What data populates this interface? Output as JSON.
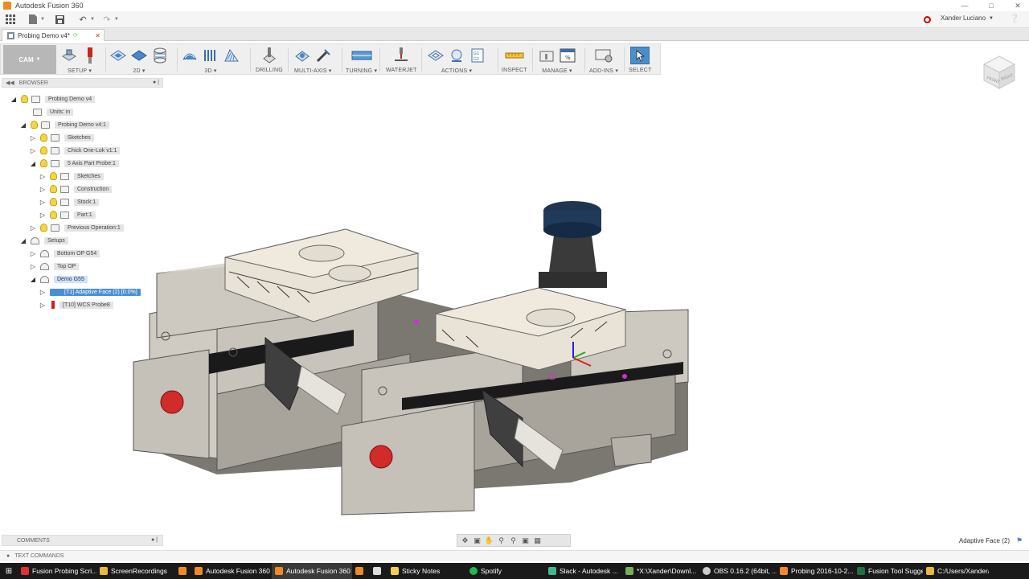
{
  "window": {
    "title": "Autodesk Fusion 360",
    "app_icon": "fusion-icon"
  },
  "quick_access": {
    "icons": [
      "grid-icon",
      "file-icon",
      "save-icon",
      "undo-icon",
      "redo-icon"
    ],
    "user": "Xander Luciano",
    "help": "?"
  },
  "document_tab": {
    "label": "Probing Demo v4*"
  },
  "toolbar": {
    "workspace": "CAM",
    "groups": [
      {
        "label": "SETUP",
        "dropdown": true,
        "icons": [
          "setup-icon",
          "tool-library-icon"
        ]
      },
      {
        "label": "2D",
        "dropdown": true,
        "icons": [
          "2d-adaptive-icon",
          "2d-pocket-icon",
          "2d-contour-icon"
        ]
      },
      {
        "label": "3D",
        "dropdown": true,
        "icons": [
          "3d-adaptive-icon",
          "3d-parallel-icon",
          "3d-scallop-icon"
        ]
      },
      {
        "label": "DRILLING",
        "dropdown": false,
        "icons": [
          "drill-icon"
        ]
      },
      {
        "label": "MULTI-AXIS",
        "dropdown": true,
        "icons": [
          "multi-axis-icon",
          "swarf-icon"
        ]
      },
      {
        "label": "TURNING",
        "dropdown": true,
        "icons": [
          "turning-icon"
        ]
      },
      {
        "label": "WATERJET",
        "dropdown": false,
        "icons": [
          "waterjet-icon"
        ]
      },
      {
        "label": "ACTIONS",
        "dropdown": true,
        "icons": [
          "simulate-icon",
          "post-process-icon",
          "nc-program-icon"
        ]
      },
      {
        "label": "INSPECT",
        "dropdown": false,
        "icons": [
          "measure-icon"
        ]
      },
      {
        "label": "MANAGE",
        "dropdown": true,
        "icons": [
          "manage-tools-icon",
          "templates-icon"
        ]
      },
      {
        "label": "ADD-INS",
        "dropdown": true,
        "icons": [
          "add-ins-icon"
        ]
      },
      {
        "label": "SELECT",
        "dropdown": false,
        "icons": [
          "select-icon"
        ]
      }
    ]
  },
  "browser": {
    "title": "BROWSER",
    "nodes": [
      {
        "label": "Probing Demo v4",
        "expanded": true,
        "bulb": true
      },
      {
        "label": "Units: in",
        "expanded": null,
        "bulb": false
      },
      {
        "label": "Probing Demo v4:1",
        "expanded": true,
        "bulb": true
      },
      {
        "label": "Sketches",
        "expanded": false,
        "bulb": true
      },
      {
        "label": "Chick One-Lok v1:1",
        "expanded": false,
        "bulb": true
      },
      {
        "label": "5 Axis Part Probe:1",
        "expanded": true,
        "bulb": true
      },
      {
        "label": "Sketches",
        "expanded": false,
        "bulb": true
      },
      {
        "label": "Construction",
        "expanded": false,
        "bulb": true
      },
      {
        "label": "Stock:1",
        "expanded": false,
        "bulb": true
      },
      {
        "label": "Part:1",
        "expanded": false,
        "bulb": true
      },
      {
        "label": "Previous Operation:1",
        "expanded": false,
        "bulb": true
      },
      {
        "label": "Setups",
        "expanded": true,
        "bulb": false
      },
      {
        "label": "Bottom OP G54",
        "expanded": false,
        "bulb": false
      },
      {
        "label": "Top OP",
        "expanded": false,
        "bulb": false
      },
      {
        "label": "Demo G55",
        "expanded": true,
        "bulb": false
      },
      {
        "label": "[T1] Adaptive Face (2) [0.0%]",
        "expanded": false,
        "bulb": false,
        "selected": true
      },
      {
        "label": "[T10] WCS Probe8",
        "expanded": false,
        "bulb": false
      }
    ]
  },
  "comments": {
    "title": "COMMENTS"
  },
  "status": {
    "selection": "Adaptive Face (2)"
  },
  "text_commands": {
    "title": "TEXT COMMANDS"
  },
  "taskbar": {
    "items": [
      {
        "label": "Fusion Probing Scri...",
        "color": "#d33"
      },
      {
        "label": "ScreenRecordings",
        "color": "#e8b93a"
      },
      {
        "label": "",
        "color": "#f08a24"
      },
      {
        "label": "Autodesk Fusion 360",
        "color": "#f08a24"
      },
      {
        "label": "Autodesk Fusion 360",
        "color": "#f08a24",
        "active": true
      },
      {
        "label": "",
        "color": "#f08a24"
      },
      {
        "label": "",
        "color": "#ddd"
      },
      {
        "label": "Sticky Notes",
        "color": "#f4d046"
      },
      {
        "label": "Spotify",
        "color": "#1db954"
      },
      {
        "label": "Slack - Autodesk ...",
        "color": "#3eb991"
      },
      {
        "label": "*X:\\Xander\\Downl...",
        "color": "#7aad58"
      },
      {
        "label": "OBS 0.16.2 (64bit, ...",
        "color": "#ccc"
      },
      {
        "label": "Probing 2016-10-2...",
        "color": "#f08a24"
      },
      {
        "label": "Fusion Tool Sugge...",
        "color": "#1e7145"
      },
      {
        "label": "C:/Users/Xander/A...",
        "color": "#e8b93a"
      }
    ]
  }
}
